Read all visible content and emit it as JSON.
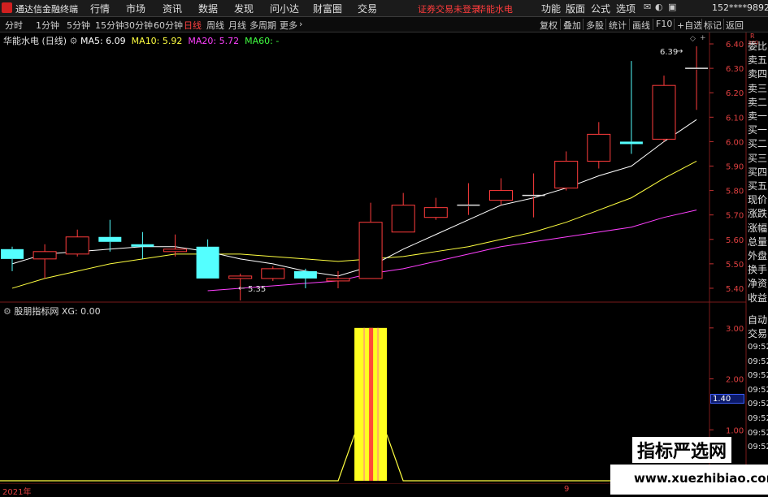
{
  "titlebar": {
    "app_title": "通达信金融终端",
    "menus": [
      "行情",
      "市场",
      "资讯",
      "数据",
      "发现",
      "问小达",
      "财富圈",
      "交易"
    ],
    "warning": "证券交易未登录",
    "stock": "华能水电",
    "right_menus": [
      "功能",
      "版面",
      "公式",
      "选项"
    ],
    "user": "152****9892"
  },
  "toolbar": {
    "periods": [
      "分时",
      "1分钟",
      "5分钟",
      "15分钟",
      "30分钟",
      "60分钟",
      "日线",
      "周线",
      "月线",
      "多周期",
      "更多"
    ],
    "active_period": "日线",
    "right_items": [
      "复权",
      "叠加",
      "多股",
      "统计",
      "画线",
      "F10",
      "+自选",
      "标记",
      "返回"
    ]
  },
  "main_chart": {
    "title": "华能水电 (日线)",
    "ma5_label": "MA5: 6.09",
    "ma10_label": "MA10: 5.92",
    "ma20_label": "MA20: 5.72",
    "ma60_label": "MA60: -",
    "high_label": "6.39",
    "low_label": "5.35",
    "yticks": [
      "6.40",
      "6.30",
      "6.20",
      "6.10",
      "6.00",
      "5.90",
      "5.80",
      "5.70",
      "5.60",
      "5.50",
      "5.40"
    ]
  },
  "sub_chart": {
    "title": "股朋指标网",
    "xg_label": "XG: 0.00",
    "yticks": [
      "3.00",
      "2.00",
      "1.00"
    ],
    "highlight_value": "1.40"
  },
  "xaxis": {
    "labels": [
      "2021年",
      "9"
    ]
  },
  "right_panel": {
    "top_label": "R",
    "top_sub": "300",
    "items": [
      "委比",
      "卖五",
      "卖四",
      "卖三",
      "卖二",
      "卖一",
      "买一",
      "买二",
      "买三",
      "买四",
      "买五",
      "现价",
      "涨跌",
      "涨幅",
      "总量",
      "外盘",
      "换手",
      "净资",
      "收益"
    ],
    "lower_items": [
      "自动",
      "交易"
    ],
    "times": [
      "09:52",
      "09:52",
      "09:52",
      "09:52",
      "09:52",
      "09:52",
      "09:52",
      "09:52"
    ]
  },
  "watermark": {
    "line1": "指标严选网",
    "line2": "www.xuezhibiao.com"
  },
  "colors": {
    "up": "#ff3c3c",
    "down": "#54ffff",
    "ma5": "#ffffff",
    "ma10": "#ffff40",
    "ma20": "#ff40ff",
    "bg": "#000000"
  },
  "chart_data": {
    "type": "candlestick",
    "candles": [
      {
        "o": 5.56,
        "h": 5.57,
        "l": 5.47,
        "c": 5.52
      },
      {
        "o": 5.52,
        "h": 5.58,
        "l": 5.44,
        "c": 5.55
      },
      {
        "o": 5.54,
        "h": 5.64,
        "l": 5.53,
        "c": 5.61
      },
      {
        "o": 5.61,
        "h": 5.68,
        "l": 5.55,
        "c": 5.59
      },
      {
        "o": 5.58,
        "h": 5.63,
        "l": 5.52,
        "c": 5.57
      },
      {
        "o": 5.55,
        "h": 5.62,
        "l": 5.53,
        "c": 5.56
      },
      {
        "o": 5.57,
        "h": 5.6,
        "l": 5.44,
        "c": 5.44
      },
      {
        "o": 5.44,
        "h": 5.46,
        "l": 5.35,
        "c": 5.45
      },
      {
        "o": 5.44,
        "h": 5.49,
        "l": 5.43,
        "c": 5.48
      },
      {
        "o": 5.47,
        "h": 5.48,
        "l": 5.4,
        "c": 5.44
      },
      {
        "o": 5.43,
        "h": 5.47,
        "l": 5.4,
        "c": 5.44
      },
      {
        "o": 5.44,
        "h": 5.75,
        "l": 5.44,
        "c": 5.67
      },
      {
        "o": 5.63,
        "h": 5.79,
        "l": 5.63,
        "c": 5.74
      },
      {
        "o": 5.69,
        "h": 5.77,
        "l": 5.68,
        "c": 5.73
      },
      {
        "o": 5.74,
        "h": 5.83,
        "l": 5.7,
        "c": 5.74
      },
      {
        "o": 5.76,
        "h": 5.85,
        "l": 5.74,
        "c": 5.8
      },
      {
        "o": 5.78,
        "h": 5.87,
        "l": 5.69,
        "c": 5.78
      },
      {
        "o": 5.81,
        "h": 5.96,
        "l": 5.8,
        "c": 5.92
      },
      {
        "o": 5.92,
        "h": 6.08,
        "l": 5.89,
        "c": 6.03
      },
      {
        "o": 6.0,
        "h": 6.33,
        "l": 5.95,
        "c": 5.99
      },
      {
        "o": 6.01,
        "h": 6.27,
        "l": 6.0,
        "c": 6.23
      },
      {
        "o": 6.3,
        "h": 6.39,
        "l": 6.13,
        "c": 6.3
      }
    ],
    "ma5": [
      5.5,
      5.54,
      5.55,
      5.56,
      5.57,
      5.57,
      5.55,
      5.52,
      5.5,
      5.47,
      5.45,
      5.49,
      5.56,
      5.62,
      5.68,
      5.74,
      5.77,
      5.81,
      5.86,
      5.9,
      6.0,
      6.09
    ],
    "ma10": [
      5.4,
      5.44,
      5.47,
      5.5,
      5.52,
      5.54,
      5.54,
      5.54,
      5.53,
      5.52,
      5.51,
      5.52,
      5.53,
      5.55,
      5.57,
      5.6,
      5.63,
      5.67,
      5.72,
      5.77,
      5.85,
      5.92
    ],
    "ma20": [
      null,
      null,
      null,
      null,
      null,
      null,
      5.39,
      5.4,
      5.41,
      5.42,
      5.43,
      5.46,
      5.48,
      5.51,
      5.54,
      5.57,
      5.59,
      5.61,
      5.63,
      5.65,
      5.69,
      5.72
    ],
    "ylim": [
      5.35,
      6.44
    ],
    "xg_signal_index": 11,
    "xg_ylim": [
      0,
      3.3
    ]
  }
}
